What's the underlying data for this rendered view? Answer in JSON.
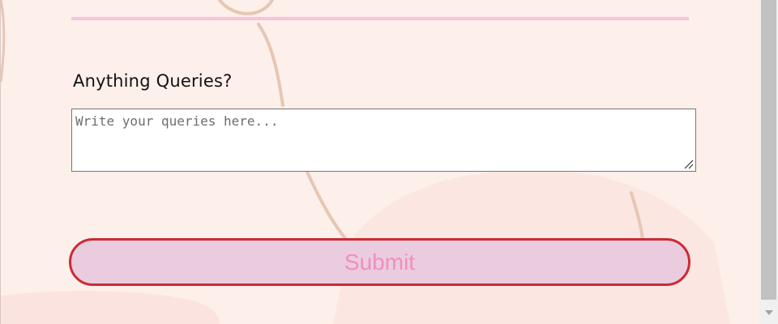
{
  "form": {
    "queries_label": "Anything Queries?",
    "queries_value": "",
    "queries_placeholder": "Write your queries here...",
    "submit_label": "Submit"
  },
  "colors": {
    "page_background": "#fdefea",
    "divider": "#f7c3de",
    "submit_background": "#eaccde",
    "submit_border": "#cc2b34",
    "submit_text": "#f08fbe"
  },
  "icons": {
    "resize_grip": "resize-grip-icon",
    "scroll_down": "chevron-down-icon"
  }
}
